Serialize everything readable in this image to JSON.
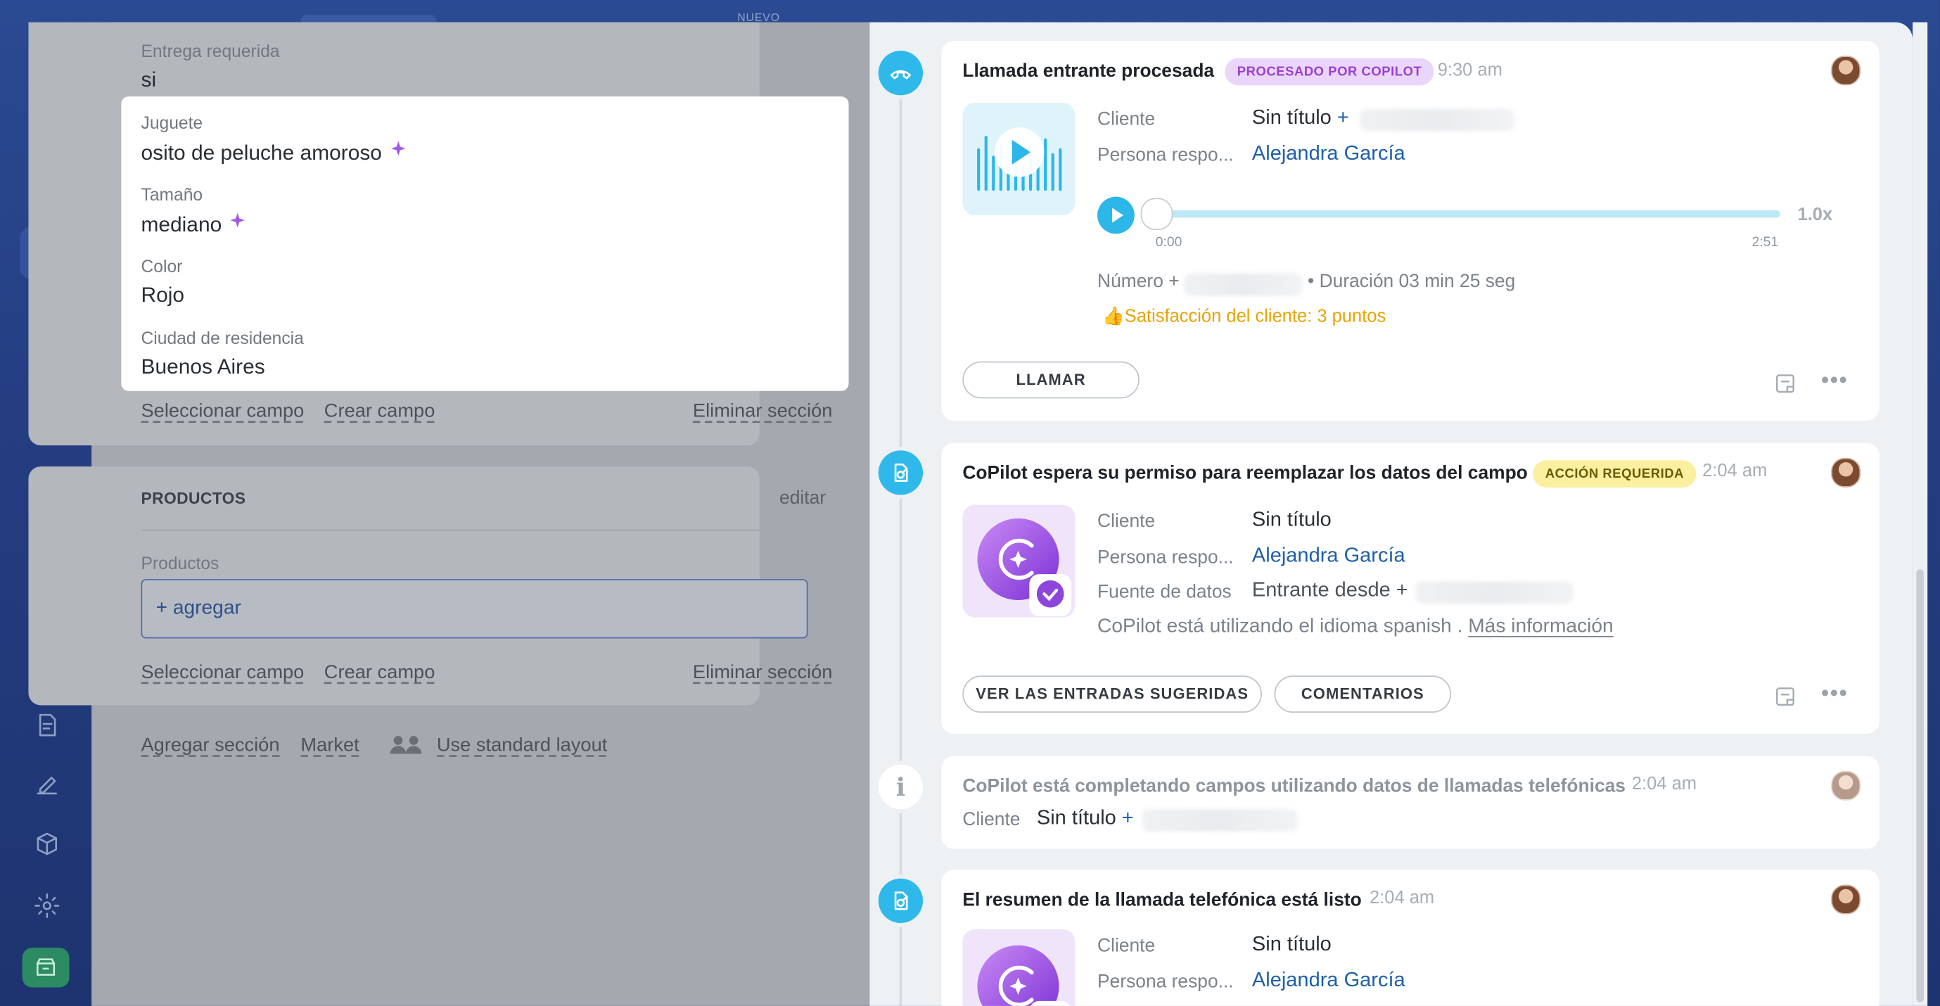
{
  "topbar": {
    "badge_nuevo": "NUEVO"
  },
  "form": {
    "entrega": {
      "label": "Entrega requerida",
      "value": "si"
    },
    "juguete": {
      "label": "Juguete",
      "value": "osito de peluche amoroso"
    },
    "tamano": {
      "label": "Tamaño",
      "value": "mediano"
    },
    "color": {
      "label": "Color",
      "value": "Rojo"
    },
    "ciudad": {
      "label": "Ciudad de residencia",
      "value": "Buenos Aires"
    },
    "section1_actions": {
      "select": "Seleccionar campo",
      "create": "Crear campo",
      "delete": "Eliminar sección"
    },
    "productos": {
      "title": "PRODUCTOS",
      "edit": "editar",
      "field_label": "Productos",
      "add": "+ agregar",
      "select": "Seleccionar campo",
      "create": "Crear campo",
      "delete": "Eliminar sección"
    },
    "bottom_links": {
      "add_section": "Agregar sección",
      "market": "Market",
      "standard_layout": "Use standard layout"
    }
  },
  "timeline": {
    "call": {
      "title": "Llamada entrante procesada",
      "badge": "PROCESADO POR COPILOT",
      "time": "9:30 am",
      "client_label": "Cliente",
      "client_value": "Sin título",
      "client_plus": "+",
      "resp_label": "Persona respo...",
      "resp_value": "Alejandra García",
      "speed": "1.0x",
      "t_start": "0:00",
      "t_end": "2:51",
      "progress": 0,
      "number_label": "Número +",
      "duration": "• Duración 03 min 25 seg",
      "satisfaction": "Satisfacción del cliente: 3 puntos",
      "call_btn": "LLAMAR"
    },
    "permission": {
      "title": "CoPilot espera su permiso para reemplazar los datos del campo",
      "badge": "ACCIÓN REQUERIDA",
      "time": "2:04 am",
      "client_label": "Cliente",
      "client_value": "Sin título",
      "resp_label": "Persona respo...",
      "resp_value": "Alejandra García",
      "source_label": "Fuente de datos",
      "source_value": "Entrante desde +",
      "language_text": "CoPilot está utilizando el idioma spanish .",
      "more_info": "Más información",
      "btn_suggested": "VER LAS ENTRADAS SUGERIDAS",
      "btn_comments": "COMENTARIOS"
    },
    "filling": {
      "title": "CoPilot está completando campos utilizando datos de llamadas telefónicas",
      "time": "2:04 am",
      "client_label": "Cliente",
      "client_value": "Sin título",
      "client_plus": "+"
    },
    "summary": {
      "title": "El resumen de la llamada telefónica está listo",
      "time": "2:04 am",
      "client_label": "Cliente",
      "client_value": "Sin título",
      "resp_label": "Persona respo...",
      "resp_value": "Alejandra García"
    }
  },
  "colors": {
    "accent": "#2fb9ea",
    "link": "#1e5fa8",
    "badge_purple_bg": "#ead6fb",
    "badge_purple_fg": "#9a3fd1",
    "badge_yellow_bg": "#fbefa0",
    "badge_yellow_fg": "#6b5a00",
    "satisfaction": "#e7a300"
  }
}
